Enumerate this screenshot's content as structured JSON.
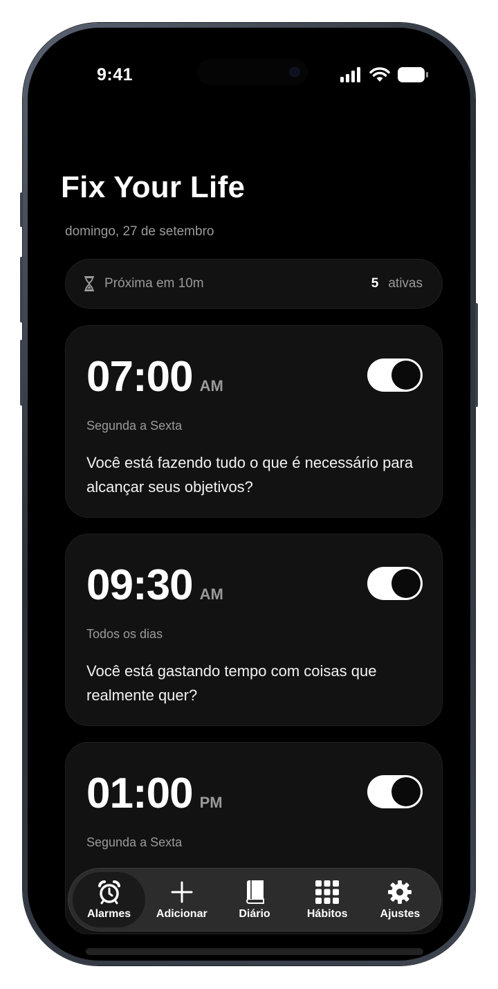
{
  "status_bar": {
    "time": "9:41"
  },
  "app": {
    "title": "Fix Your Life",
    "date": "domingo, 27 de setembro"
  },
  "summary": {
    "next_label": "Próxima em 10m",
    "active_count": "5",
    "active_label": "ativas"
  },
  "alarms": [
    {
      "time": "07:00",
      "ampm": "AM",
      "days": "Segunda a Sexta",
      "message": "Você está fazendo tudo o que é necessário para alcançar seus objetivos?",
      "enabled": true
    },
    {
      "time": "09:30",
      "ampm": "AM",
      "days": "Todos os dias",
      "message": "Você está gastando tempo com coisas que realmente quer?",
      "enabled": true
    },
    {
      "time": "01:00",
      "ampm": "PM",
      "days": "Segunda a Sexta",
      "message": "",
      "enabled": true
    }
  ],
  "tabs": [
    {
      "label": "Alarmes",
      "icon": "alarm-clock-icon",
      "active": true
    },
    {
      "label": "Adicionar",
      "icon": "plus-icon",
      "active": false
    },
    {
      "label": "Diário",
      "icon": "book-icon",
      "active": false
    },
    {
      "label": "Hábitos",
      "icon": "grid-icon",
      "active": false
    },
    {
      "label": "Ajustes",
      "icon": "gear-icon",
      "active": false
    }
  ],
  "colors": {
    "background": "#000000",
    "card": "#121212",
    "muted_text": "#9a9a9a",
    "toggle_on": "#ffffff"
  }
}
